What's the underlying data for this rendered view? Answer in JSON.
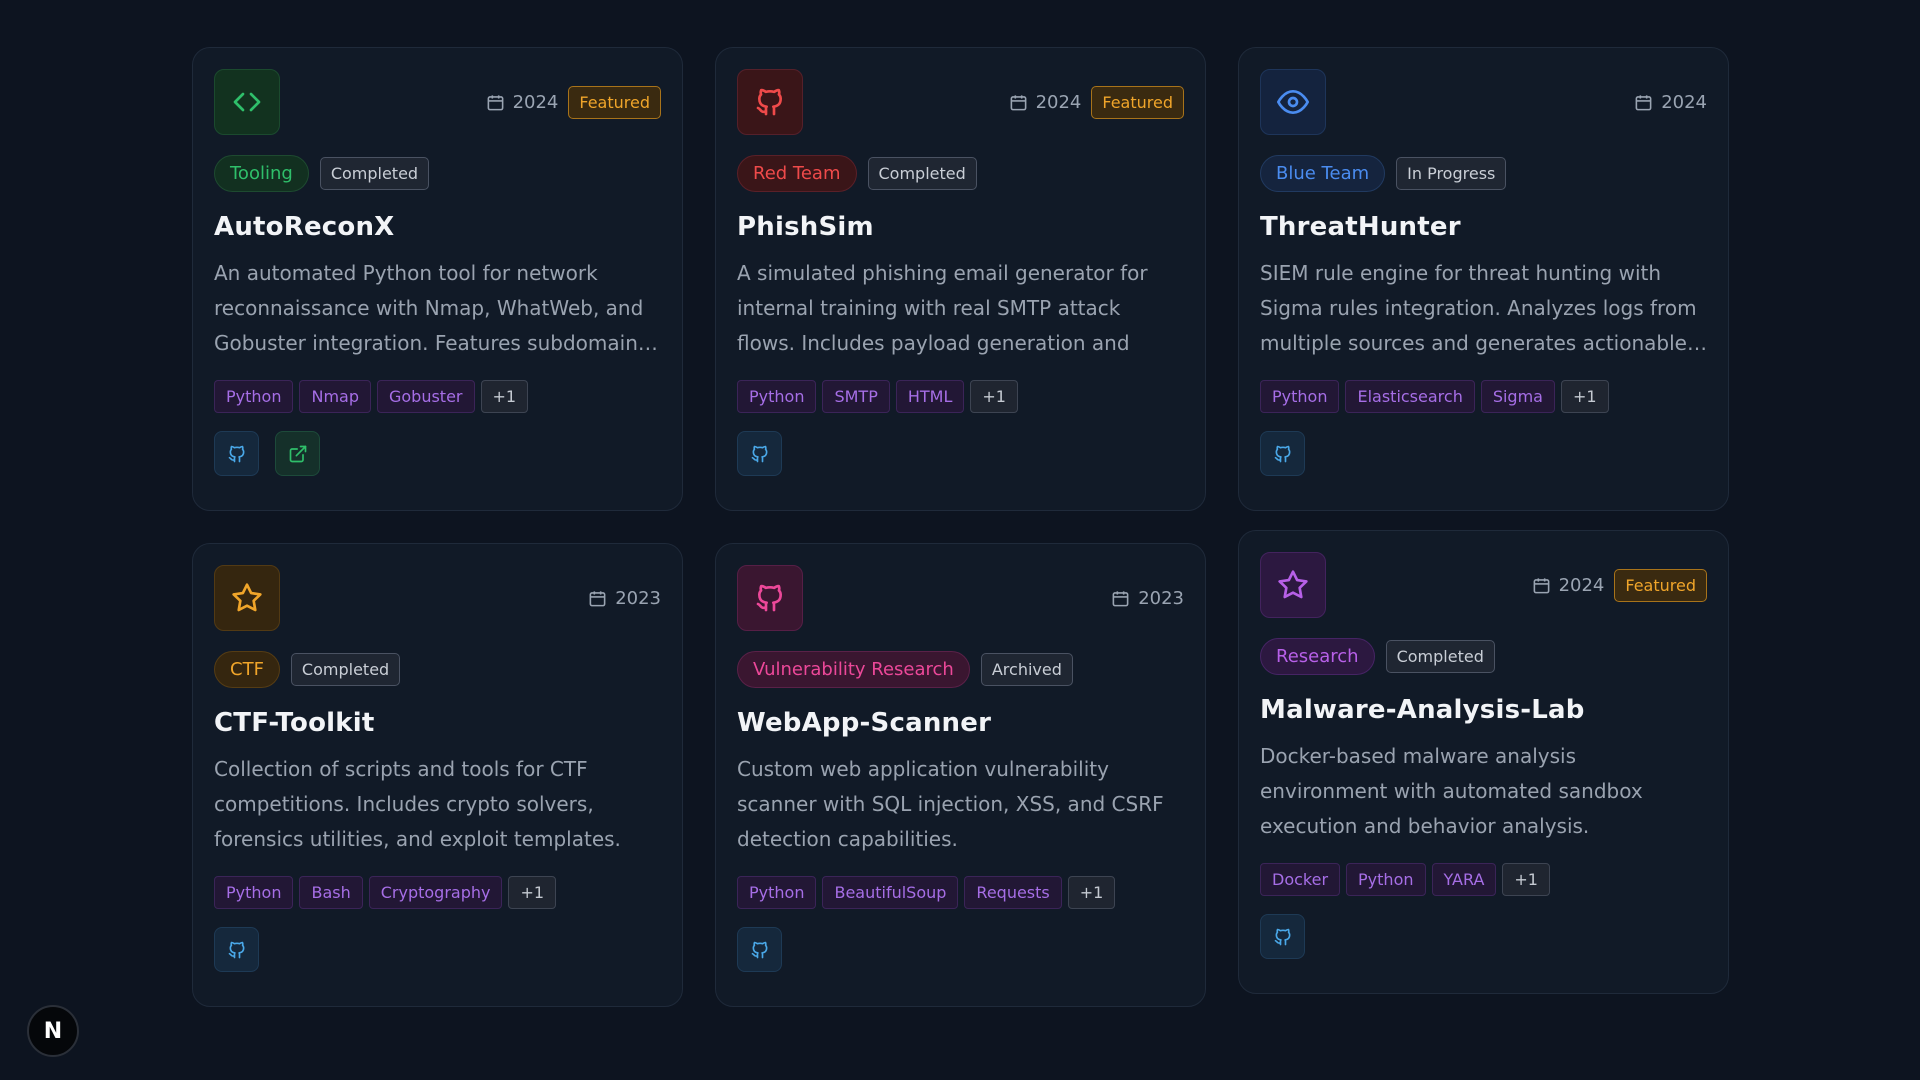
{
  "projects": [
    {
      "icon": "code-icon",
      "year": "2024",
      "featured": "Featured",
      "category": "Tooling",
      "status": "Completed",
      "title": "AutoReconX",
      "description": "An automated Python tool for network reconnaissance with Nmap, WhatWeb, and Gobuster integration. Features subdomain…",
      "tags": [
        "Python",
        "Nmap",
        "Gobuster",
        "+1"
      ],
      "links": [
        "github",
        "external"
      ]
    },
    {
      "icon": "github-icon",
      "year": "2024",
      "featured": "Featured",
      "category": "Red Team",
      "status": "Completed",
      "title": "PhishSim",
      "description": "A simulated phishing email generator for internal training with real SMTP attack flows. Includes payload generation and social…",
      "tags": [
        "Python",
        "SMTP",
        "HTML",
        "+1"
      ],
      "links": [
        "github"
      ]
    },
    {
      "icon": "eye-icon",
      "year": "2024",
      "featured": "",
      "category": "Blue Team",
      "status": "In Progress",
      "title": "ThreatHunter",
      "description": "SIEM rule engine for threat hunting with Sigma rules integration. Analyzes logs from multiple sources and generates actionable…",
      "tags": [
        "Python",
        "Elasticsearch",
        "Sigma",
        "+1"
      ],
      "links": [
        "github"
      ]
    },
    {
      "icon": "star-icon",
      "year": "2023",
      "featured": "",
      "category": "CTF",
      "status": "Completed",
      "title": "CTF-Toolkit",
      "description": "Collection of scripts and tools for CTF competitions. Includes crypto solvers, forensics utilities, and exploit templates.",
      "tags": [
        "Python",
        "Bash",
        "Cryptography",
        "+1"
      ],
      "links": [
        "github"
      ]
    },
    {
      "icon": "github-icon",
      "year": "2023",
      "featured": "",
      "category": "Vulnerability Research",
      "status": "Archived",
      "title": "WebApp-Scanner",
      "description": "Custom web application vulnerability scanner with SQL injection, XSS, and CSRF detection capabilities.",
      "tags": [
        "Python",
        "BeautifulSoup",
        "Requests",
        "+1"
      ],
      "links": [
        "github"
      ]
    },
    {
      "icon": "star-icon",
      "year": "2024",
      "featured": "Featured",
      "category": "Research",
      "status": "Completed",
      "title": "Malware-Analysis-Lab",
      "description": "Docker-based malware analysis environment with automated sandbox execution and behavior analysis.",
      "tags": [
        "Docker",
        "Python",
        "YARA",
        "+1"
      ],
      "links": [
        "github"
      ]
    }
  ],
  "colors": {
    "tooling": "#2fbf6a",
    "red_team": "#ef4a4a",
    "blue_team": "#4a8cf0",
    "ctf": "#f0a52a",
    "vuln_research": "#ec4899",
    "research": "#b760e8"
  },
  "corner_logo": "N"
}
